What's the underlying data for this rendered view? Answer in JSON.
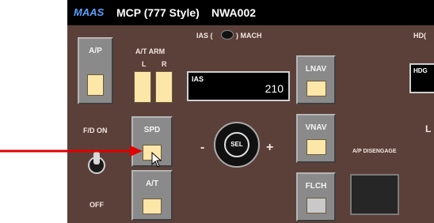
{
  "title": {
    "logo": "MAAS",
    "name": "MCP (777 Style)",
    "code": "NWA002"
  },
  "labels": {
    "at_arm": "A/T ARM",
    "l": "L",
    "r": "R",
    "ias_mach_prefix": "IAS (",
    "ias_mach_suffix": ") MACH",
    "hdg_partial": "HD(",
    "fd_on": "F/D ON",
    "off": "OFF",
    "ap_disengage": "A/P DISENGAGE",
    "minus": "-",
    "plus": "+",
    "l_partial": "L"
  },
  "buttons": {
    "ap": "A/P",
    "spd": "SPD",
    "at": "A/T",
    "lnav": "LNAV",
    "vnav": "VNAV",
    "flch": "FLCH",
    "sel": "SEL"
  },
  "ias_window": {
    "label": "IAS",
    "value": "210"
  },
  "hdg_window": {
    "label": "HDG"
  },
  "colors": {
    "panel": "#5b4039",
    "light_on": "#fce6a8",
    "arrow": "#e00000"
  }
}
